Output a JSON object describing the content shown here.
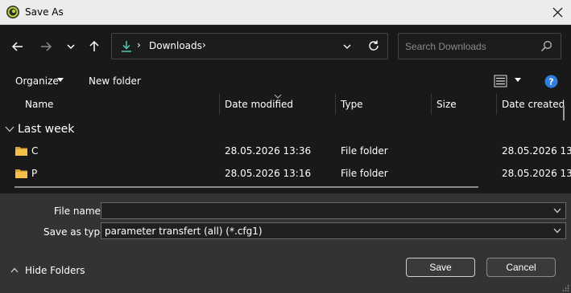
{
  "window": {
    "title": "Save As",
    "app_icon": "app-logo-icon",
    "close_icon": "close-icon"
  },
  "nav": {
    "back_icon": "arrow-left-icon",
    "forward_icon": "arrow-right-icon",
    "recent_icon": "chevron-down-icon",
    "up_icon": "arrow-up-icon",
    "address": {
      "location_icon": "download-icon",
      "crumbs": [
        "Downloads"
      ],
      "separator": "›",
      "dropdown_icon": "chevron-down-icon",
      "refresh_icon": "refresh-icon"
    },
    "search": {
      "placeholder": "Search Downloads",
      "icon": "search-icon"
    }
  },
  "toolbar": {
    "organize_label": "Organize",
    "new_folder_label": "New folder",
    "view_icon": "view-list-icon",
    "help_icon": "help-icon"
  },
  "file_list": {
    "columns": [
      "Name",
      "Date modified",
      "Type",
      "Size",
      "Date created"
    ],
    "sorted_column": "Date modified",
    "groups": [
      {
        "label": "Last week",
        "rows": [
          {
            "name": "C",
            "date_modified": "28.05.2026 13:36",
            "type": "File folder",
            "size": "",
            "date_created": "28.05.2026 13"
          },
          {
            "name": "P",
            "date_modified": "28.05.2026 13:16",
            "type": "File folder",
            "size": "",
            "date_created": "28.05.2026 13"
          }
        ]
      }
    ]
  },
  "form": {
    "file_name_label": "File name:",
    "file_name_value": "",
    "save_as_type_label": "Save as type:",
    "save_as_type_value": "parameter transfert (all) (*.cfg1)"
  },
  "footer": {
    "hide_folders_label": "Hide Folders",
    "save_label": "Save",
    "cancel_label": "Cancel"
  },
  "colors": {
    "background": "#191919",
    "bottom_panel": "#333333",
    "titlebar": "#ececec",
    "accent_download": "#4cc2a5",
    "folder": "#f5c04a",
    "help": "#2f7fe0"
  }
}
